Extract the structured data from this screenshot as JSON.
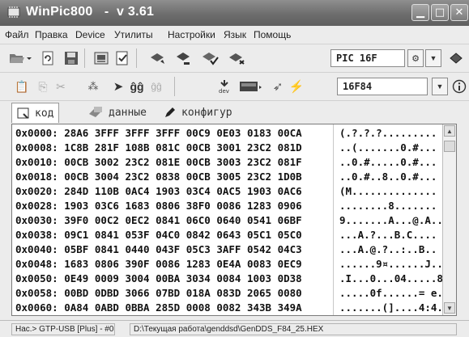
{
  "window": {
    "title": "WinPic800   -  v 3.61"
  },
  "menu": [
    "Файл",
    "Правка",
    "Device",
    "Утилиты",
    "Настройки",
    "Язык",
    "Помощь"
  ],
  "toolbar": {
    "family_select": "PIC 16F",
    "device_select": "16F84",
    "dev_label": "dev"
  },
  "tabs": [
    {
      "label": "код",
      "icon": "code-page-icon"
    },
    {
      "label": "данные",
      "icon": "data-icon"
    },
    {
      "label": "конфигур",
      "icon": "config-pencil-icon"
    }
  ],
  "hex_rows": [
    {
      "addr": "0x0000:",
      "words": [
        "28A6",
        "3FFF",
        "3FFF",
        "3FFF",
        "00C9",
        "0E03",
        "0183",
        "00CA"
      ],
      "ascii": "(.?.?.?........."
    },
    {
      "addr": "0x0008:",
      "words": [
        "1C8B",
        "281F",
        "108B",
        "081C",
        "00CB",
        "3001",
        "23C2",
        "081D"
      ],
      "ascii": "..(.......0.#..."
    },
    {
      "addr": "0x0010:",
      "words": [
        "00CB",
        "3002",
        "23C2",
        "081E",
        "00CB",
        "3003",
        "23C2",
        "081F"
      ],
      "ascii": "..0.#.....0.#..."
    },
    {
      "addr": "0x0018:",
      "words": [
        "00CB",
        "3004",
        "23C2",
        "0838",
        "00CB",
        "3005",
        "23C2",
        "1D0B"
      ],
      "ascii": "..0.#..8..0.#..."
    },
    {
      "addr": "0x0020:",
      "words": [
        "284D",
        "110B",
        "0AC4",
        "1903",
        "03C4",
        "0AC5",
        "1903",
        "0AC6"
      ],
      "ascii": "(M.............."
    },
    {
      "addr": "0x0028:",
      "words": [
        "1903",
        "03C6",
        "1683",
        "0806",
        "38F0",
        "0086",
        "1283",
        "0906"
      ],
      "ascii": "........8......."
    },
    {
      "addr": "0x0030:",
      "words": [
        "39F0",
        "00C2",
        "0EC2",
        "0841",
        "06C0",
        "0640",
        "0541",
        "06BF"
      ],
      "ascii": "9.......A...@.A.."
    },
    {
      "addr": "0x0038:",
      "words": [
        "09C1",
        "0841",
        "053F",
        "04C0",
        "0842",
        "0643",
        "05C1",
        "05C0"
      ],
      "ascii": "...A.?...B.C...."
    },
    {
      "addr": "0x0040:",
      "words": [
        "05BF",
        "0841",
        "0440",
        "043F",
        "05C3",
        "3AFF",
        "0542",
        "04C3"
      ],
      "ascii": "...A.@.?..:..B.."
    },
    {
      "addr": "0x0048:",
      "words": [
        "1683",
        "0806",
        "390F",
        "0086",
        "1283",
        "0E4A",
        "0083",
        "0EC9"
      ],
      "ascii": "......9¤......J...."
    },
    {
      "addr": "0x0050:",
      "words": [
        "0E49",
        "0009",
        "3004",
        "00BA",
        "3034",
        "0084",
        "1003",
        "0D38"
      ],
      "ascii": ".I...0...04.....8"
    },
    {
      "addr": "0x0058:",
      "words": [
        "00BD",
        "0DBD",
        "3066",
        "07BD",
        "018A",
        "083D",
        "2065",
        "0080"
      ],
      "ascii": ".....0f......= e.."
    },
    {
      "addr": "0x0060:",
      "words": [
        "0A84",
        "0ABD",
        "0BBA",
        "285D",
        "0008",
        "0082",
        "343B",
        "349A"
      ],
      "ascii": ".......(]....4:4."
    }
  ],
  "status": {
    "programmer": "Нас.> GTP-USB [Plus] - #0",
    "file_path": "D:\\Текущая работа\\genddsd\\GenDDS_F84_25.HEX"
  }
}
